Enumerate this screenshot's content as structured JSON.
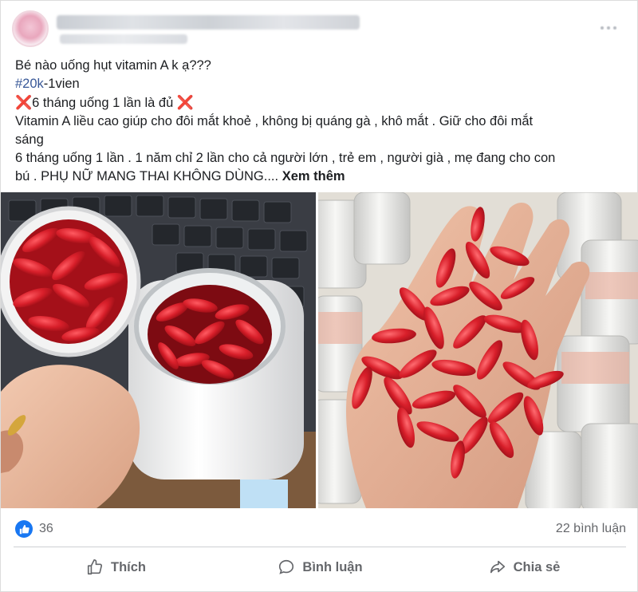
{
  "post": {
    "lines": {
      "line1": "Bé nào uống hụt vitamin A k ạ???",
      "hashtag": "#20k",
      "hashtag_rest": "-1vien",
      "line3_mark_left": "❌",
      "line3_text": "6 tháng uống 1 lần là đủ ",
      "line3_mark_right": "❌",
      "line4": "Vitamin A liều cao giúp cho đôi mắt khoẻ , không bị quáng gà , khô mắt . Giữ cho đôi mắt",
      "line5": "sáng",
      "line6": "6 tháng uống 1 lần . 1 năm chỉ 2 lần cho cả người lớn , trẻ em , người già , mẹ đang cho con",
      "line7": "bú . PHỤ NỮ MANG THAI KHÔNG DÙNG....",
      "see_more": "Xem thêm"
    }
  },
  "stats": {
    "like_count": "36",
    "comment_count": "22 bình luận"
  },
  "actions": {
    "like": "Thích",
    "comment": "Bình luận",
    "share": "Chia sẻ"
  },
  "colors": {
    "accent": "#1877f2",
    "hashtag": "#385898",
    "muted": "#65676b",
    "capsule": "#d81f2a"
  },
  "icons": {
    "like_badge": "thumbs-up-icon",
    "like_action": "thumbs-up-outline-icon",
    "comment_action": "comment-bubble-icon",
    "share_action": "share-arrow-icon"
  }
}
